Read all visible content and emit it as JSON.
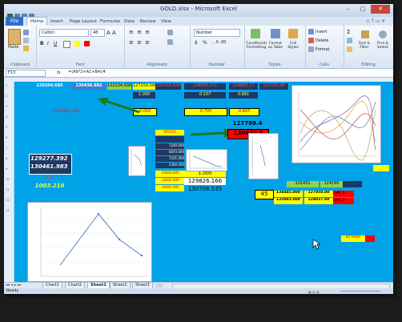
{
  "window": {
    "title": "GOLD.xlsx - Microsoft Excel",
    "minimize": "–",
    "maximize": "□",
    "close": "✕"
  },
  "ribbon_tabs": [
    "File",
    "Home",
    "Insert",
    "Page Layout",
    "Formulas",
    "Data",
    "Review",
    "View"
  ],
  "ribbon": {
    "clipboard": {
      "label": "Clipboard",
      "paste": "Paste"
    },
    "font": {
      "label": "Font",
      "name": "Calibri",
      "size": "48",
      "bold": "B",
      "italic": "I",
      "underline": "U"
    },
    "alignment": {
      "label": "Alignment"
    },
    "number": {
      "label": "Number",
      "format": "Number",
      "currency": "$",
      "percent": "%"
    },
    "styles": {
      "label": "Styles",
      "conditional": "Conditional Formatting",
      "format_table": "Format as Table",
      "cell_styles": "Cell Styles"
    },
    "cells": {
      "label": "Cells",
      "insert": "Insert",
      "delete": "Delete",
      "format": "Format"
    },
    "editing": {
      "label": "Editing",
      "sum": "Σ",
      "sort": "Sort & Filter",
      "find": "Find & Select"
    }
  },
  "formula_bar": {
    "name_box": "F13",
    "fx": "fx",
    "formula": "=(A9*2+A1+B4)/4"
  },
  "cells": {
    "r1": [
      "129104.685",
      "130436.982",
      "132134.000",
      "127259.000",
      "132359.429",
      "128805.371",
      "128805.17",
      "127720.46"
    ],
    "r2": [
      "1.000",
      "0.107",
      "0.681"
    ],
    "r4": [
      "131455.193",
      "0.050",
      "0.700",
      "0.665"
    ],
    "t1": "127799.4",
    "t2": "130840.8",
    "left1": "129277.392",
    "left2": "130461.983",
    "left_small": "0.000",
    "left_yellow": "1003.210",
    "mid_small": [
      "900120",
      "7240.000",
      "6874.000",
      "7241.000",
      "3300.000"
    ],
    "mid_yellow": [
      "-20000.000",
      "-10000.000",
      "-30000.000"
    ],
    "mid_right": [
      "1.000",
      "129826.166",
      "130706.535"
    ],
    "r_row1": [
      "131431",
      "124190"
    ],
    "r_45": "45",
    "r_vals": [
      "134445.000",
      "127850.00",
      "132883.000",
      "124037.00"
    ],
    "day": [
      "DAY 2",
      "DAY 3"
    ],
    "bottom_right": "45.0000"
  },
  "sheet_tabs": [
    "Chart1",
    "Chart2",
    "Sheet1",
    "Sheet2",
    "Sheet3"
  ],
  "active_sheet": "Sheet1",
  "status": "Ready",
  "colors": {
    "grid_bg": "#00a2e8",
    "yellow": "#ffff00",
    "navy": "#1f3864",
    "green": "#92d050",
    "red": "#ff0000"
  }
}
